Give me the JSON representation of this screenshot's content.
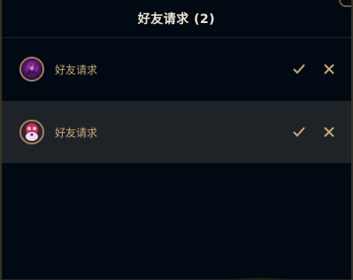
{
  "header": {
    "title": "好友请求 (2)"
  },
  "requests": [
    {
      "label": "好友请求",
      "avatar_icon": "purple-champion-avatar-icon"
    },
    {
      "label": "好友请求",
      "avatar_icon": "pink-poro-avatar-icon"
    }
  ],
  "actions": {
    "accept_icon": "checkmark-icon",
    "decline_icon": "close-icon"
  },
  "colors": {
    "background": "#010a13",
    "row_highlight": "#1e2328",
    "gold_text": "#c8aa6e",
    "title_text": "#f0e6d2",
    "avatar_border": "#a08655"
  }
}
